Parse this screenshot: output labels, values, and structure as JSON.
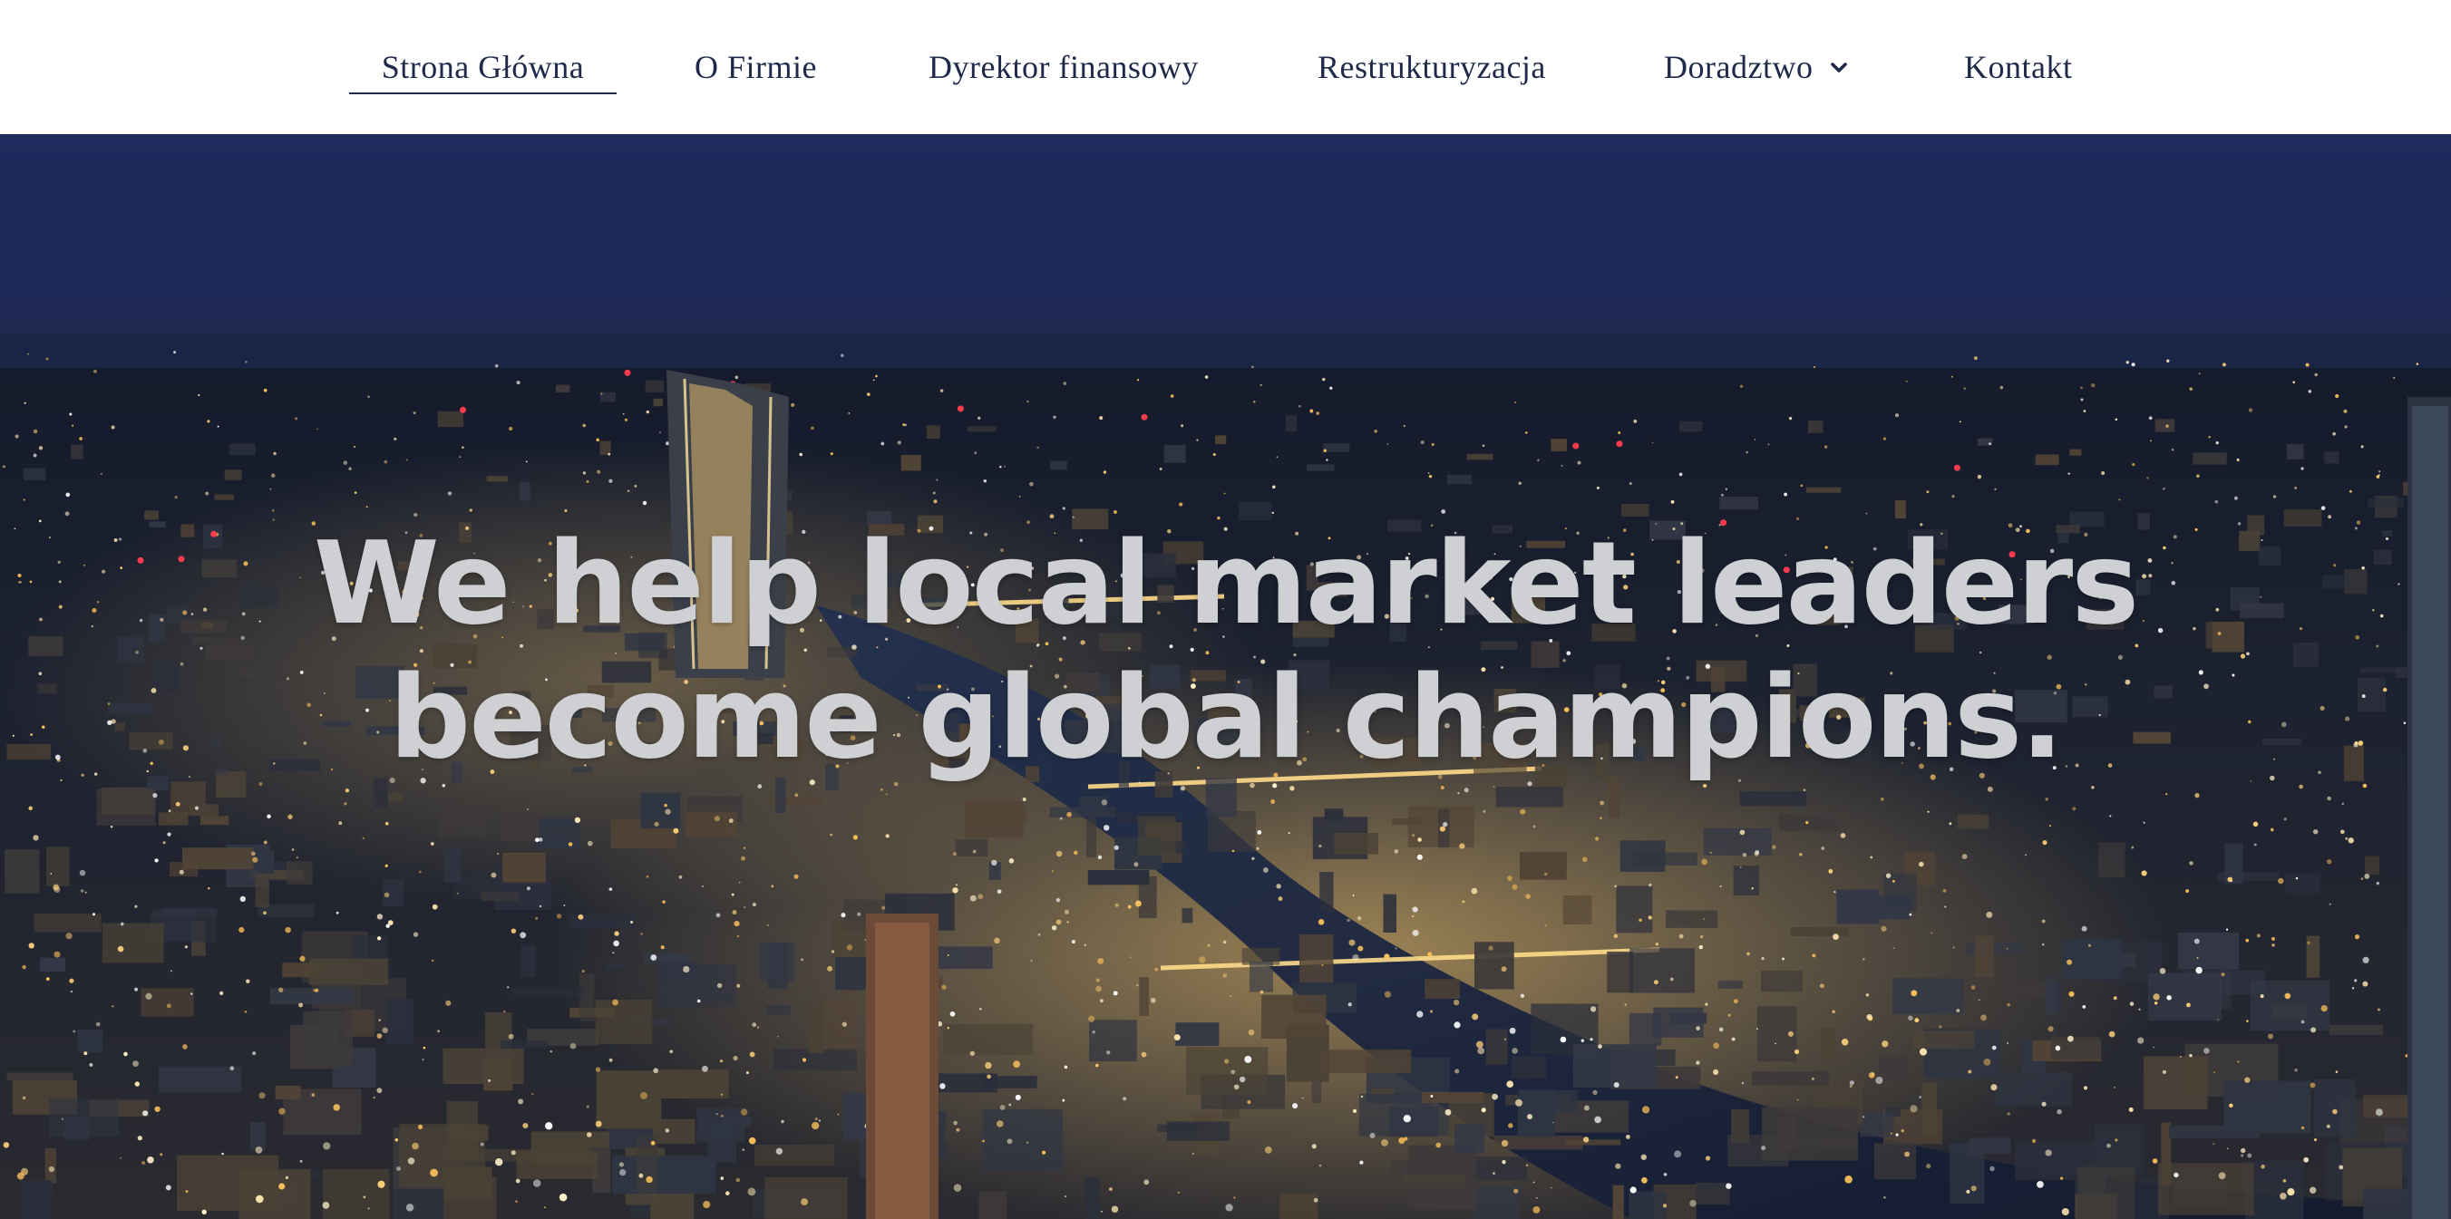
{
  "nav": {
    "items": [
      {
        "label": "Strona Główna",
        "active": true
      },
      {
        "label": "O Firmie"
      },
      {
        "label": "Dyrektor finansowy"
      },
      {
        "label": "Restrukturyzacja"
      },
      {
        "label": "Doradztwo",
        "has_dropdown": true,
        "icon": "chevron-down-icon"
      },
      {
        "label": "Kontakt"
      }
    ]
  },
  "hero": {
    "headline_line1": "We help local market leaders",
    "headline_line2": "become global champions."
  },
  "colors": {
    "nav_text": "#1f2a4a",
    "sky": "#1e2b5e",
    "headline": "#cfd0d3",
    "city_lights": "#ffd27a"
  }
}
